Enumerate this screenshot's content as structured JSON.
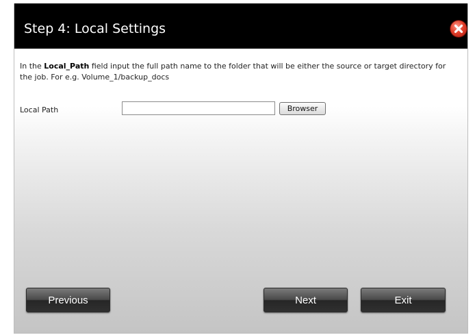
{
  "dialog": {
    "title": "Step 4: Local Settings",
    "close_icon": "close-x-icon"
  },
  "instructions": {
    "prefix": "In the ",
    "field_name": "Local_Path",
    "suffix": " field input the full path name to the folder that will be either the source or target directory for the job. For e.g. Volume_1/backup_docs"
  },
  "form": {
    "local_path_label": "Local Path",
    "local_path_value": "",
    "browse_label": "Browser"
  },
  "buttons": {
    "previous": "Previous",
    "next": "Next",
    "exit": "Exit"
  },
  "colors": {
    "titlebar": "#000000",
    "close_button": "#e2402c",
    "button_dark": "#303030"
  }
}
